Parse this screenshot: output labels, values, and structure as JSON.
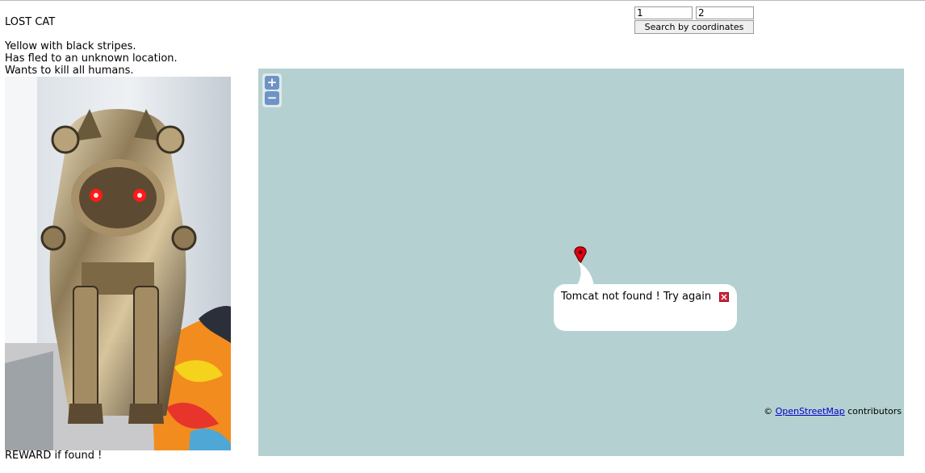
{
  "poster": {
    "title": "LOST CAT",
    "description": [
      "Yellow with black stripes.",
      "Has fled to an unknown location.",
      "Wants to kill all humans."
    ],
    "reward": "REWARD if found !"
  },
  "search": {
    "lat_value": "1",
    "lon_value": "2",
    "button_label": "Search by coordinates"
  },
  "map": {
    "zoom_in": "+",
    "zoom_out": "−",
    "popup_text": "Tomcat not found ! Try again",
    "attribution_prefix": "©",
    "attribution_link": "OpenStreetMap",
    "attribution_suffix": "contributors",
    "water_color": "#b5d0d0",
    "marker_color": "#e0000f"
  }
}
